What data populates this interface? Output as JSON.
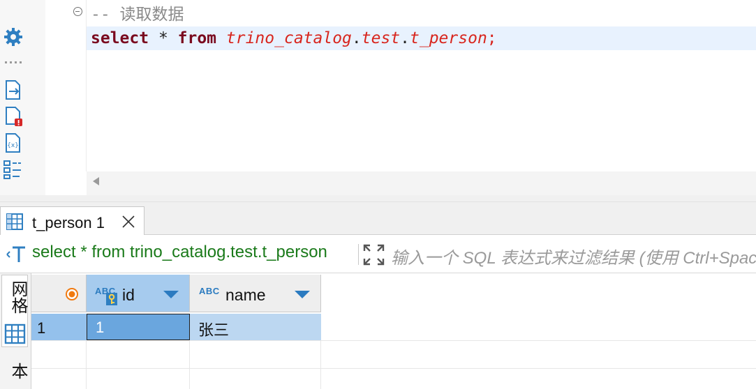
{
  "editor": {
    "comment": "-- 读取数据",
    "sql_tokens": [
      {
        "text": "select",
        "kind": "keyword"
      },
      {
        "text": " * ",
        "kind": "plain"
      },
      {
        "text": "from",
        "kind": "keyword"
      },
      {
        "text": " ",
        "kind": "plain"
      },
      {
        "text": "trino_catalog",
        "kind": "identifier"
      },
      {
        "text": ".",
        "kind": "dot"
      },
      {
        "text": "test",
        "kind": "identifier"
      },
      {
        "text": ".",
        "kind": "dot"
      },
      {
        "text": "t_person",
        "kind": "identifier"
      },
      {
        "text": ";",
        "kind": "semicolon"
      }
    ]
  },
  "toolbar": {
    "icons": [
      "gear-icon",
      "drag-handle-icon",
      "export-file-icon",
      "file-error-icon",
      "variables-file-icon",
      "outline-icon"
    ]
  },
  "result_tab": {
    "label": "t_person 1"
  },
  "filter": {
    "query": "select * from trino_catalog.test.t_person",
    "placeholder": "输入一个 SQL 表达式来过滤结果 (使用 Ctrl+Spac"
  },
  "side_tabs": {
    "grid": "网格",
    "text": "文本"
  },
  "grid": {
    "type_badge": "ABC",
    "columns": [
      {
        "name": "id"
      },
      {
        "name": "name"
      }
    ],
    "rows": [
      {
        "num": "1",
        "id": "1",
        "name": "张三"
      }
    ]
  },
  "colors": {
    "keyword": "#7a0a1f",
    "identifier": "#d8261e",
    "filter_text": "#1a7a1a",
    "accent_blue": "#2b7bc0",
    "selection": "#6aa6de"
  }
}
